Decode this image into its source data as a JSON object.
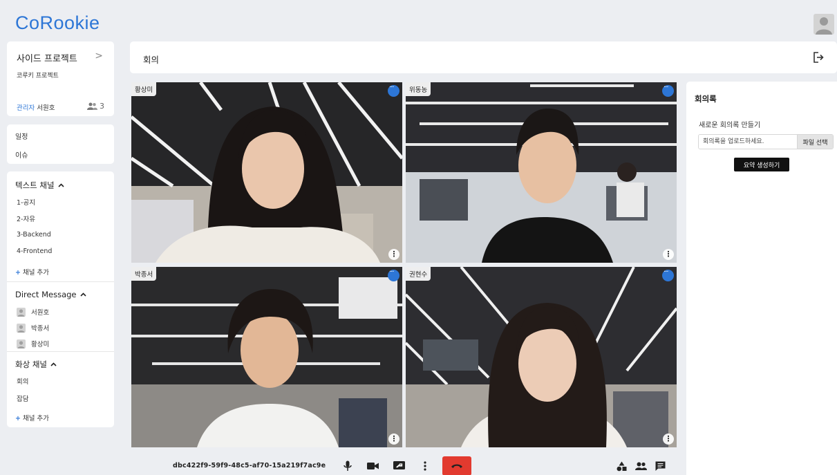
{
  "app": {
    "logo": "CoRookie"
  },
  "project": {
    "title": "사이드 프로젝트",
    "chevron": ">",
    "subtitle": "코루키 프로젝트",
    "admin_label": "관리자",
    "admin_name": "서원호",
    "member_count": "3"
  },
  "menu": {
    "schedule": "일정",
    "issues": "이슈"
  },
  "text_channels": {
    "title": "텍스트 채널",
    "items": [
      "1-공지",
      "2-자유",
      "3-Backend",
      "4-Frontend"
    ],
    "add_label": "채널 추가"
  },
  "direct_messages": {
    "title": "Direct Message",
    "users": [
      "서원호",
      "박종서",
      "황상미"
    ]
  },
  "video_channels": {
    "title": "화상 채널",
    "items": [
      "회의",
      "잡담"
    ],
    "add_label": "채널 추가"
  },
  "header": {
    "title": "회의"
  },
  "participants": [
    {
      "name": "황상미"
    },
    {
      "name": "위동농"
    },
    {
      "name": "박종서"
    },
    {
      "name": "권현수"
    }
  ],
  "minutes": {
    "title": "회의록",
    "subtitle": "새로운 회의록 만들기",
    "placeholder": "회의록을 업로드하세요.",
    "file_button": "파일 선택",
    "generate_button": "요약 생성하기"
  },
  "call": {
    "room_id": "dbc422f9-59f9-48c5-af70-15a219f7ac9e"
  },
  "colors": {
    "accent": "#2d76d6",
    "hangup": "#e23a2f",
    "background": "#eceef2"
  }
}
